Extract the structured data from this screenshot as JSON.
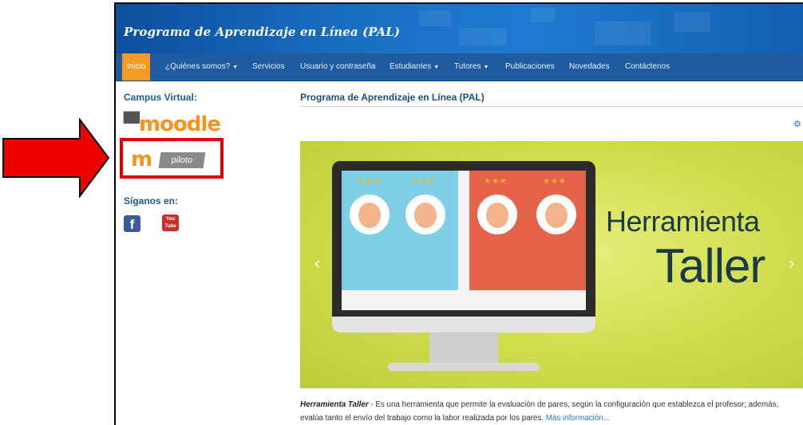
{
  "site": {
    "title": "Programa de Aprendizaje en Línea (PAL)"
  },
  "nav": {
    "items": [
      {
        "label": "Inicio",
        "active": true
      },
      {
        "label": "¿Quiénes somos?",
        "dropdown": true
      },
      {
        "label": "Servicios"
      },
      {
        "label": "Usuario y contraseña"
      },
      {
        "label": "Estudiantes",
        "dropdown": true
      },
      {
        "label": "Tutores",
        "dropdown": true
      },
      {
        "label": "Publicaciones"
      },
      {
        "label": "Novedades"
      },
      {
        "label": "Contáctenos"
      }
    ]
  },
  "sidebar": {
    "campus_heading": "Campus Virtual:",
    "moodle_logo_text": "moodle",
    "piloto_label": "piloto",
    "follow_heading": "Síganos en:",
    "social": [
      {
        "name": "facebook",
        "glyph": "f"
      },
      {
        "name": "youtube",
        "glyph_top": "You",
        "glyph_bottom": "Tube"
      }
    ]
  },
  "content": {
    "title": "Programa de Aprendizaje en Línea (PAL)",
    "banner": {
      "heading_line1": "Herramienta",
      "heading_line2": "Taller",
      "prev_arrow": "‹",
      "next_arrow": "›"
    },
    "caption": {
      "lead": "Herramienta Taller",
      "separator": " - ",
      "text": "Es una herramienta que permite la evaluación de pares, según la configuración que establezca el profesor; además, evalúa tanto el envío del trabajo como la labor realizada por los pares.",
      "more_link": "Más información..."
    }
  },
  "colors": {
    "header_blue": "#1a6fc2",
    "nav_blue": "#1e5b9f",
    "nav_active": "#f59a23",
    "moodle_orange": "#f7931e",
    "highlight_red": "#e00000",
    "banner_green": "#cfdc4a"
  }
}
